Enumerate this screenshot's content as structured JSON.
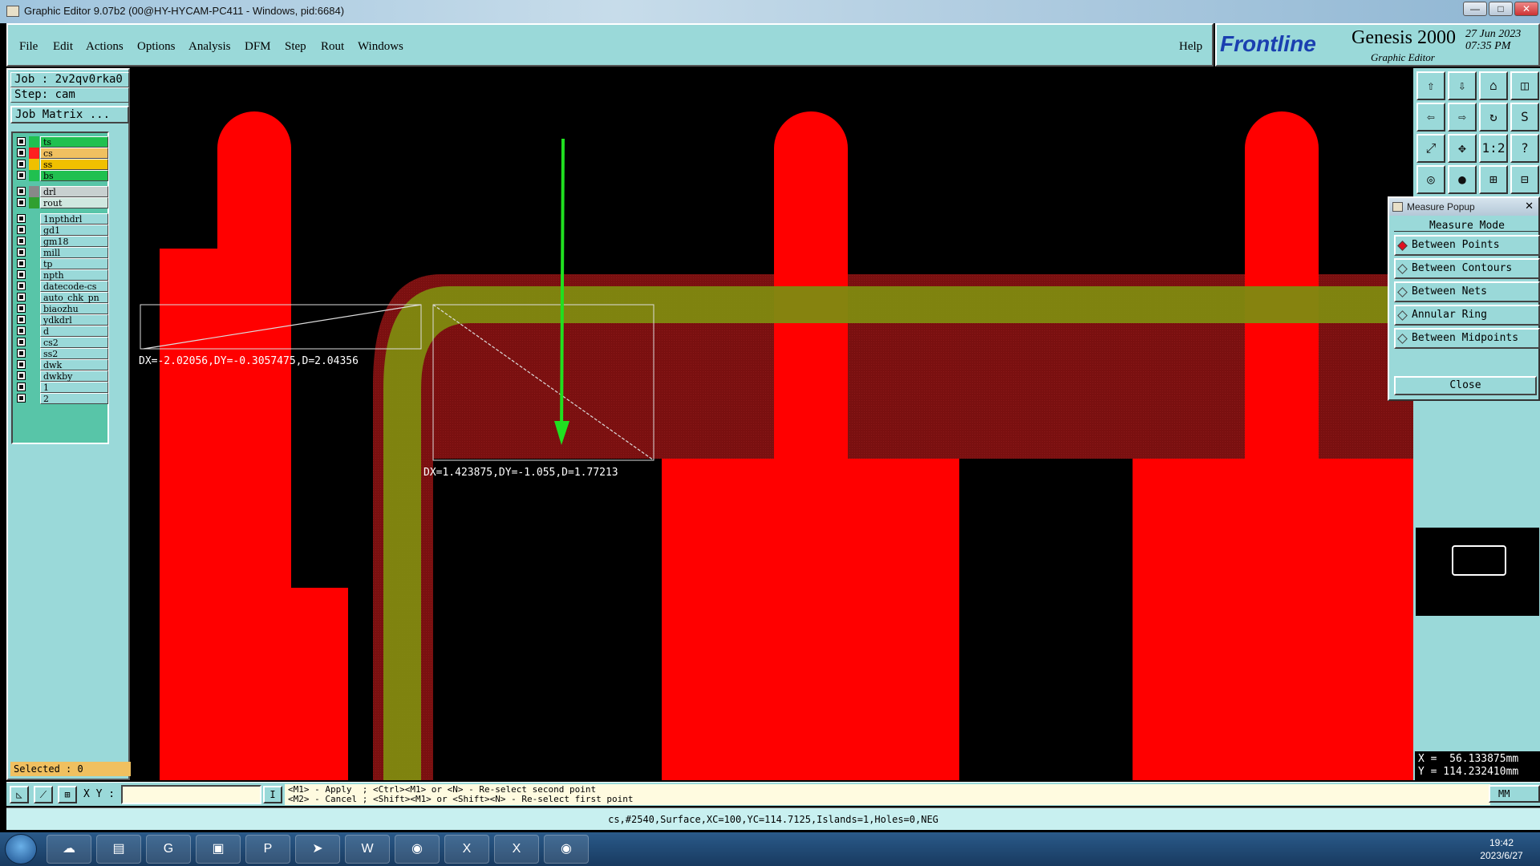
{
  "window": {
    "title": "Graphic Editor 9.07b2 (00@HY-HYCAM-PC411 - Windows, pid:6684)",
    "minimize": "—",
    "maximize": "□",
    "close": "✕"
  },
  "menu": {
    "items": [
      "File",
      "Edit",
      "Actions",
      "Options",
      "Analysis",
      "DFM",
      "Step",
      "Rout",
      "Windows"
    ],
    "help": "Help"
  },
  "brand": {
    "logo": "Frontline",
    "product": "Genesis 2000",
    "subtitle": "Graphic Editor",
    "date": "27 Jun 2023",
    "time": "07:35 PM"
  },
  "job": {
    "job_label": "Job : 2v2qv0rka0",
    "step_label": "Step: cam",
    "matrix_button": "Job Matrix ..."
  },
  "layers": [
    {
      "name": "ts",
      "color": "#20c050"
    },
    {
      "name": "cs",
      "color": "#ff2020",
      "active": true
    },
    {
      "name": "ss",
      "color": "#f0c000"
    },
    {
      "name": "bs",
      "color": "#20c050"
    },
    {
      "name": "drl",
      "color": "#888888"
    },
    {
      "name": "rout",
      "color": "#30a030"
    },
    {
      "name": "1npthdrl"
    },
    {
      "name": "gd1"
    },
    {
      "name": "gm18"
    },
    {
      "name": "mill"
    },
    {
      "name": "tp"
    },
    {
      "name": "npth"
    },
    {
      "name": "datecode-cs"
    },
    {
      "name": "auto_chk_pn"
    },
    {
      "name": "biaozhu"
    },
    {
      "name": "ydkdrl"
    },
    {
      "name": "d"
    },
    {
      "name": "cs2"
    },
    {
      "name": "ss2"
    },
    {
      "name": "dwk"
    },
    {
      "name": "dwkby"
    },
    {
      "name": "1"
    },
    {
      "name": "2"
    }
  ],
  "selected": "Selected : 0",
  "measurements": {
    "m1": "DX=-2.02056,DY=-0.3057475,D=2.04356",
    "m2": "DX=1.423875,DY=-1.055,D=1.77213"
  },
  "toolbar_icons": [
    "up-icon",
    "down-icon",
    "home-icon",
    "panel-icon",
    "left-icon",
    "right-icon",
    "loop-icon",
    "step-icon",
    "fit-icon",
    "zoom-icon",
    "ratio-icon",
    "help-icon",
    "eye-icon",
    "pin-icon",
    "net-icon",
    "net2-icon"
  ],
  "toolbar_glyphs": [
    "⇧",
    "⇩",
    "⌂",
    "◫",
    "⇦",
    "⇨",
    "↻",
    "S",
    "⤢",
    "✥",
    "1:2",
    "?",
    "◎",
    "●",
    "⊞",
    "⊟"
  ],
  "measure_popup": {
    "title": "Measure Popup",
    "close_x": "✕",
    "heading": "Measure Mode",
    "modes": [
      "Between Points",
      "Between Contours",
      "Between Nets",
      "Annular Ring",
      "Between Midpoints"
    ],
    "close": "Close"
  },
  "coords": {
    "x": "X =  56.133875mm",
    "y": "Y = 114.232410mm"
  },
  "cmd": {
    "xy_label": "X Y :",
    "xy_value": "",
    "hint1": "<M1> - Apply  ; <Ctrl><M1> or <N> - Re-select second point",
    "hint2": "<M2> - Cancel ; <Shift><M1> or <Shift><N> - Re-select first point",
    "units": "MM"
  },
  "status": "cs,#2540,Surface,XC=100,YC=114.7125,Islands=1,Holes=0,NEG",
  "taskbar": {
    "apps": [
      "☁",
      "▤",
      "G",
      "▣",
      "P",
      "➤",
      "W",
      "◉",
      "X",
      "X",
      "◉"
    ],
    "time": "19:42",
    "date": "2023/6/27"
  },
  "colors": {
    "panel": "#9ad9d9",
    "copper": "#ff0000",
    "mask": "#7a1010",
    "silk": "#808a10",
    "arrow": "#20e020"
  }
}
